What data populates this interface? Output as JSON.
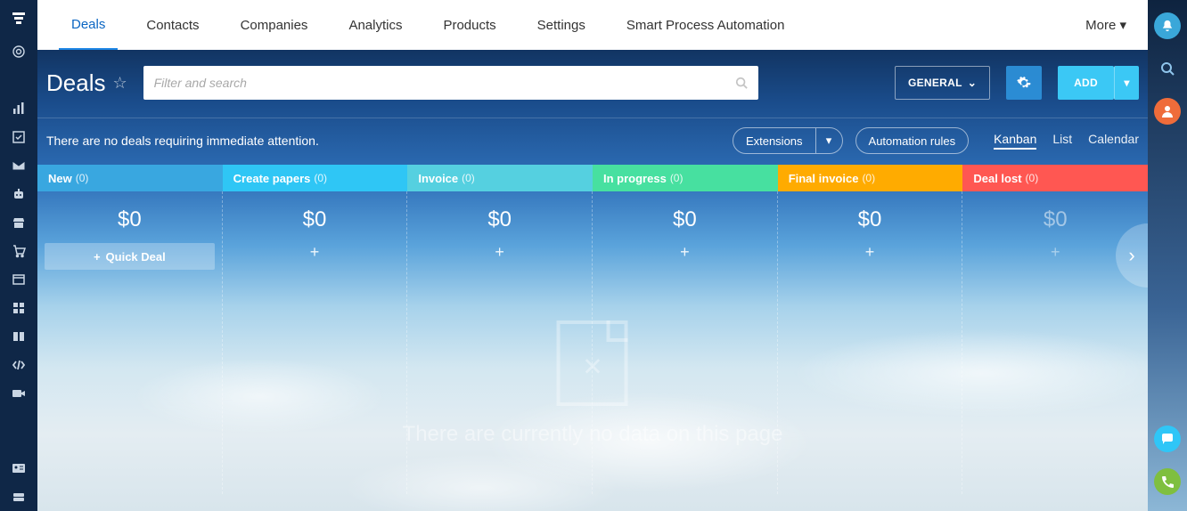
{
  "nav": {
    "items": [
      "Deals",
      "Contacts",
      "Companies",
      "Analytics",
      "Products",
      "Settings",
      "Smart Process Automation"
    ],
    "active": 0,
    "more": "More"
  },
  "page": {
    "title": "Deals",
    "search_placeholder": "Filter and search"
  },
  "actions": {
    "general": "GENERAL",
    "add": "ADD"
  },
  "subheader": {
    "notice": "There are no deals requiring immediate attention.",
    "extensions": "Extensions",
    "automation": "Automation rules",
    "views": [
      "Kanban",
      "List",
      "Calendar"
    ],
    "active_view": 0
  },
  "stages": [
    {
      "name": "New",
      "count": "(0)",
      "amount": "$0"
    },
    {
      "name": "Create papers",
      "count": "(0)",
      "amount": "$0"
    },
    {
      "name": "Invoice",
      "count": "(0)",
      "amount": "$0"
    },
    {
      "name": "In progress",
      "count": "(0)",
      "amount": "$0"
    },
    {
      "name": "Final invoice",
      "count": "(0)",
      "amount": "$0"
    },
    {
      "name": "Deal lost",
      "count": "(0)",
      "amount": "$0"
    }
  ],
  "quick_deal": "Quick Deal",
  "empty_text": "There are currently no data on this page"
}
